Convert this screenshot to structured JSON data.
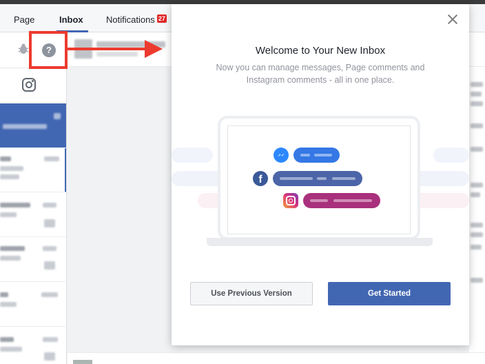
{
  "tabs": {
    "page": "Page",
    "inbox": "Inbox",
    "notifications": "Notifications",
    "notifications_count": "27"
  },
  "icons": {
    "bug": "bug-icon",
    "help": "help-icon",
    "instagram_filter": "instagram-icon",
    "close": "close-icon",
    "messenger": "messenger-icon",
    "facebook": "facebook-icon",
    "instagram": "instagram-icon"
  },
  "modal": {
    "title": "Welcome to Your New Inbox",
    "subtitle": "Now you can manage messages, Page comments and Instagram comments - all in one place.",
    "previous_button": "Use Previous Version",
    "start_button": "Get Started"
  },
  "colors": {
    "accent": "#4267b2",
    "highlight": "#ec3b2e",
    "badge": "#e02828",
    "messenger": "#2d88ff",
    "facebook": "#3b5998",
    "instagram_pill": "#a8307d"
  },
  "illustration_glyphs": {
    "facebook_letter": "f"
  }
}
